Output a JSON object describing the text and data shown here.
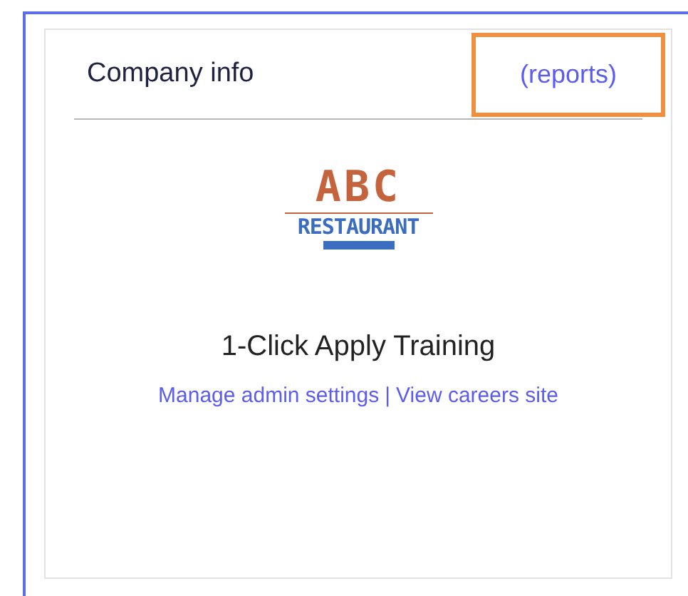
{
  "card": {
    "title": "Company info",
    "reports_link": {
      "label": "(reports)",
      "highlighted": true
    },
    "logo": {
      "line_1": "ABC",
      "line_2": "RESTAURANT"
    },
    "company_name": "1-Click Apply Training",
    "links": [
      {
        "label": "Manage admin settings"
      },
      {
        "label": "View careers site"
      }
    ],
    "link_separator": "|"
  }
}
